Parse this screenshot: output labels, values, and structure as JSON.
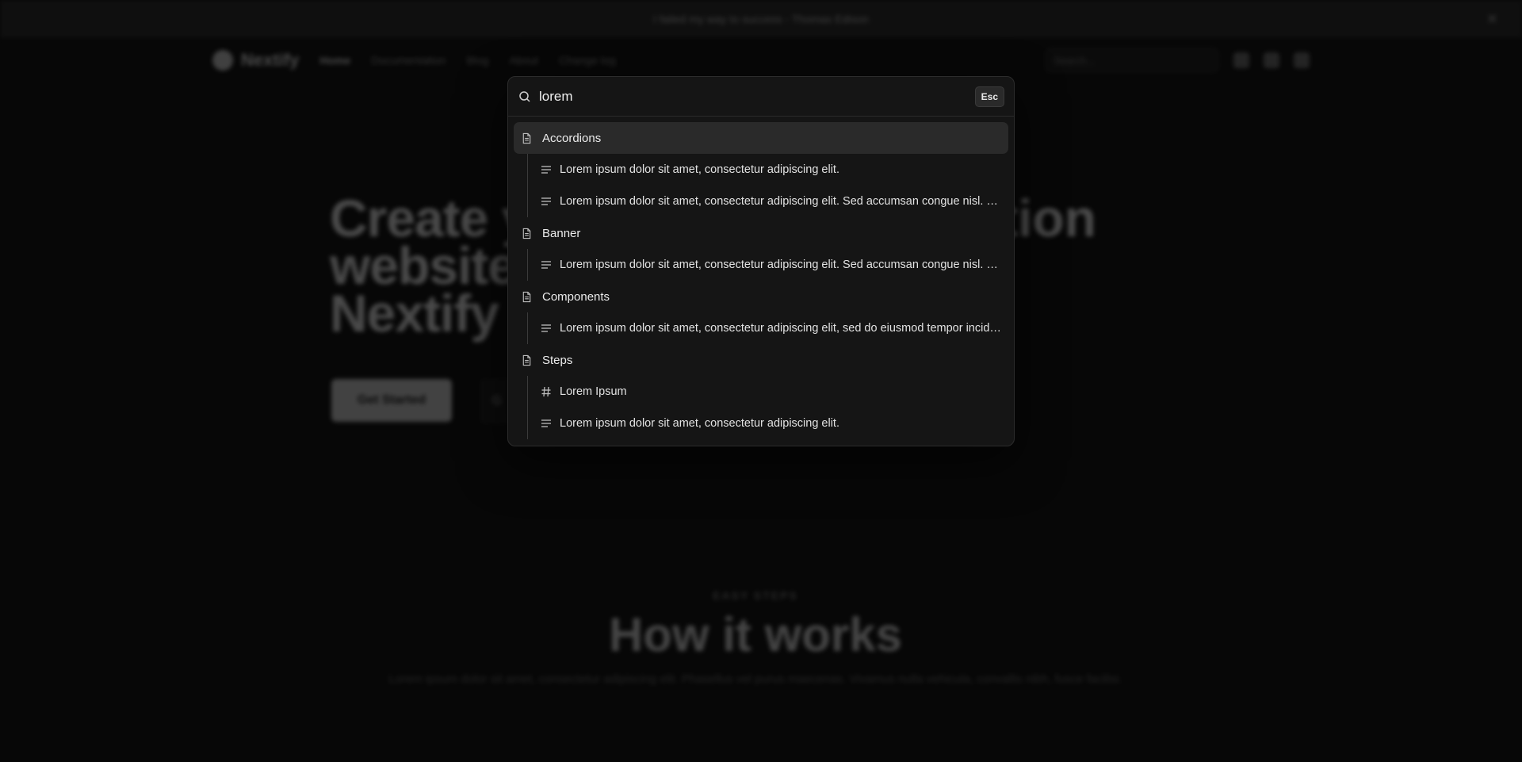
{
  "banner": {
    "text": "I failed my way to success - Thomas Edison",
    "close": "✕"
  },
  "nav": {
    "brand": "Nextify",
    "links": [
      "Home",
      "Documentation",
      "Blog",
      "About",
      "Change log"
    ],
    "search_placeholder": "Search..."
  },
  "hero": {
    "line1": "Create y",
    "line2": "website",
    "line3": "Nextify",
    "line1_tail": "tion",
    "cta_primary": "Get Started",
    "cta_secondary": "G"
  },
  "how": {
    "eyebrow": "EASY STEPS",
    "title": "How it works",
    "subtitle": "Lorem ipsum dolor sit amet, consectetur adipiscing elit. Phasellus vel purus maecenas. Vivamus nulla vehicula, convallis nibh, fusce facilisi."
  },
  "palette": {
    "query": "lorem",
    "esc_label": "Esc",
    "results": [
      {
        "kind": "page",
        "icon": "document-icon",
        "label": "Accordions",
        "active": true
      },
      {
        "kind": "sub",
        "icon": "paragraph-icon",
        "label": "Lorem ipsum dolor sit amet, consectetur adipiscing elit."
      },
      {
        "kind": "sub",
        "icon": "paragraph-icon",
        "label": "Lorem ipsum dolor sit amet, consectetur adipiscing elit. Sed accumsan congue nisl. Vestibulum."
      },
      {
        "kind": "page",
        "icon": "document-icon",
        "label": "Banner"
      },
      {
        "kind": "sub",
        "icon": "paragraph-icon",
        "label": "Lorem ipsum dolor sit amet, consectetur adipiscing elit. Sed accumsan congue nisl. Vestibulum."
      },
      {
        "kind": "page",
        "icon": "document-icon",
        "label": "Components"
      },
      {
        "kind": "sub",
        "icon": "paragraph-icon",
        "label": "Lorem ipsum dolor sit amet, consectetur adipiscing elit, sed do eiusmod tempor incididunt."
      },
      {
        "kind": "page",
        "icon": "document-icon",
        "label": "Steps"
      },
      {
        "kind": "sub",
        "icon": "hash-icon",
        "label": "Lorem Ipsum"
      },
      {
        "kind": "sub",
        "icon": "paragraph-icon",
        "label": "Lorem ipsum dolor sit amet, consectetur adipiscing elit."
      }
    ]
  }
}
